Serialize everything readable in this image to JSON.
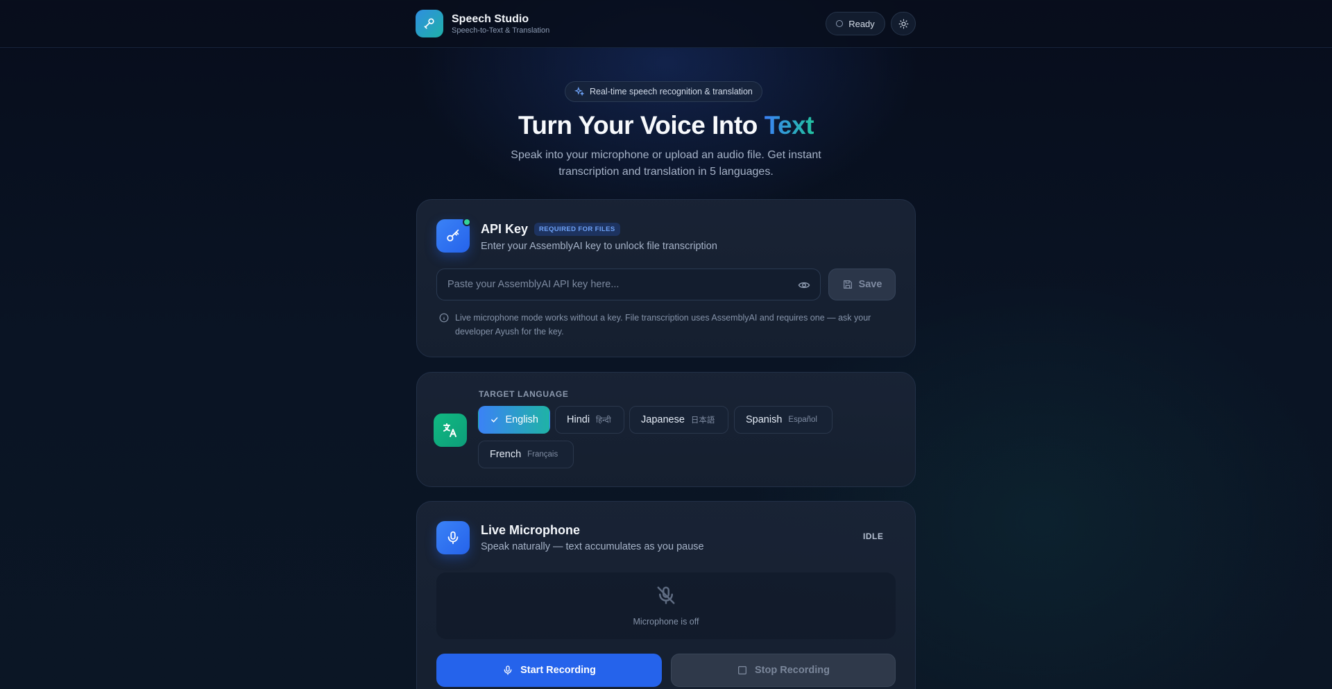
{
  "header": {
    "title": "Speech Studio",
    "subtitle": "Speech-to-Text & Translation",
    "status": "Ready",
    "logo_icon": "microphone-icon",
    "theme_icon": "sun-icon"
  },
  "hero": {
    "badge": "Real-time speech recognition & translation",
    "title_main": "Turn Your Voice Into",
    "title_accent": "Text",
    "description": "Speak into your microphone or upload an audio file. Get instant transcription and translation in 5 languages."
  },
  "api_key": {
    "title": "API Key",
    "badge": "REQUIRED FOR FILES",
    "subtitle": "Enter your AssemblyAI key to unlock file transcription",
    "input_placeholder": "Paste your AssemblyAI API key here...",
    "input_value": "",
    "save_label": "Save",
    "info": "Live microphone mode works without a key. File transcription uses AssemblyAI and requires one — ask your developer Ayush for the key."
  },
  "language": {
    "label": "TARGET LANGUAGE",
    "selected": "English",
    "options": [
      {
        "name": "English",
        "native": ""
      },
      {
        "name": "Hindi",
        "native": "हिन्दी"
      },
      {
        "name": "Japanese",
        "native": "日本語"
      },
      {
        "name": "Spanish",
        "native": "Español"
      },
      {
        "name": "French",
        "native": "Français"
      }
    ]
  },
  "mic": {
    "title": "Live Microphone",
    "subtitle": "Speak naturally — text accumulates as you pause",
    "state": "IDLE",
    "off_label": "Microphone is off",
    "start_label": "Start Recording",
    "stop_label": "Stop Recording"
  },
  "colors": {
    "accent_blue": "#2563eb",
    "accent_teal": "#1fb3a6",
    "status_green": "#34d399"
  }
}
